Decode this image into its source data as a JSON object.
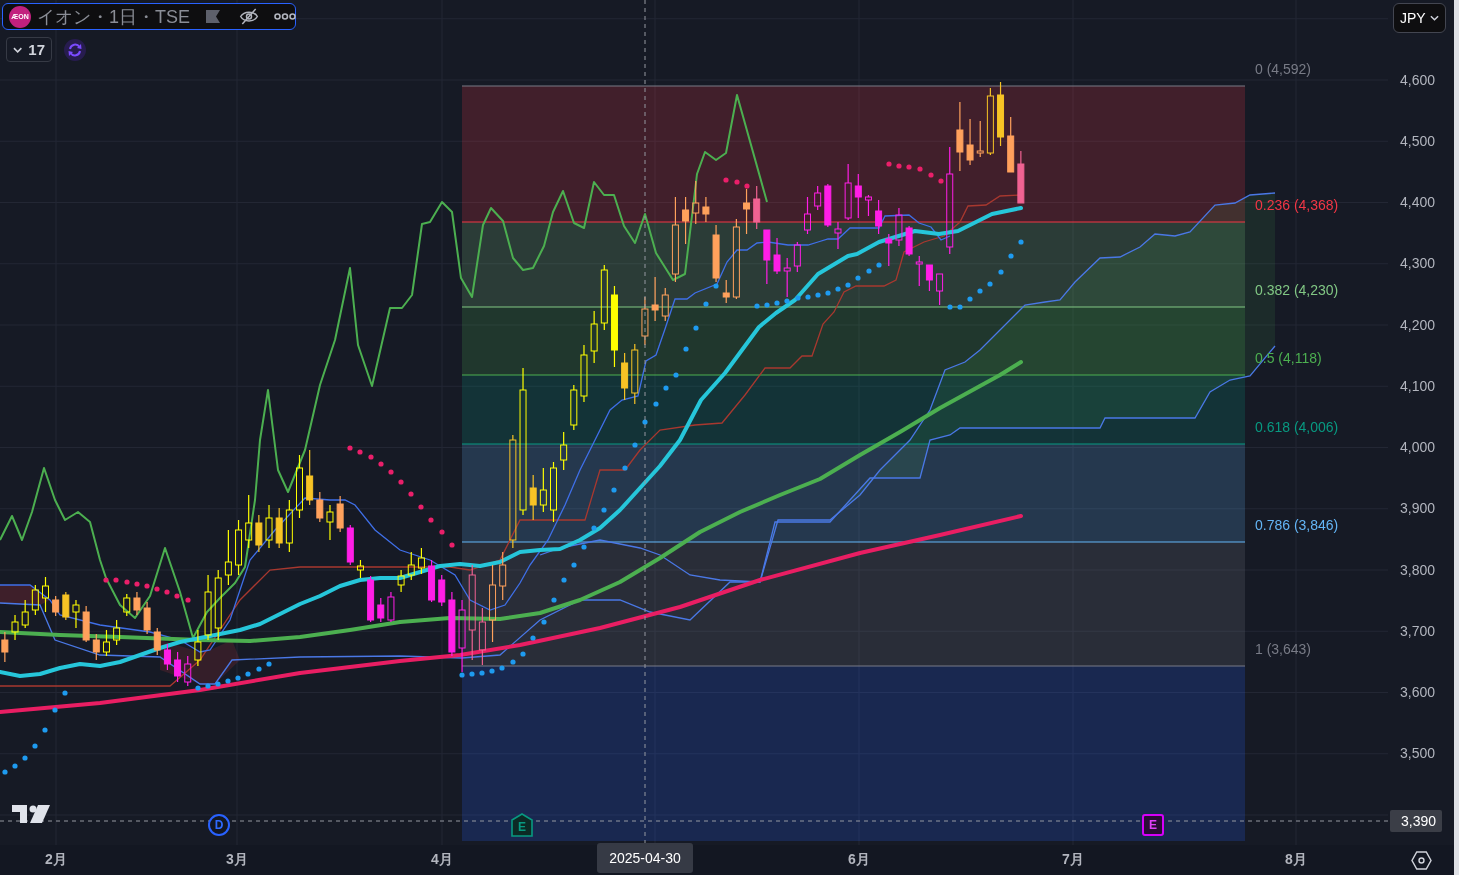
{
  "legend": {
    "logo_text": "ÆON",
    "title": "イオン・1日・TSE",
    "indicator_count": "17"
  },
  "currency_button": {
    "label": "JPY"
  },
  "fibonacci": {
    "levels": [
      {
        "label": "0 (4,592)",
        "color": "#787b86"
      },
      {
        "label": "0.236 (4,368)",
        "color": "#f23645"
      },
      {
        "label": "0.382 (4,230)",
        "color": "#81c784"
      },
      {
        "label": "0.5 (4,118)",
        "color": "#4caf50"
      },
      {
        "label": "0.618 (4,006)",
        "color": "#089981"
      },
      {
        "label": "0.786 (3,846)",
        "color": "#64b5f6"
      },
      {
        "label": "1 (3,643)",
        "color": "#787b86"
      }
    ]
  },
  "events": [
    {
      "kind": "dividend",
      "label": "D"
    },
    {
      "kind": "earnings",
      "label": "E"
    },
    {
      "kind": "earnings_upcoming",
      "label": "E"
    }
  ],
  "price_axis": {
    "labels": [
      "4,600",
      "4,500",
      "4,400",
      "4,300",
      "4,200",
      "4,100",
      "4,000",
      "3,900",
      "3,800",
      "3,700",
      "3,600",
      "3,500"
    ],
    "crosshair_price": "3,390"
  },
  "time_axis": {
    "labels": [
      "2月",
      "3月",
      "4月",
      "6月",
      "7月",
      "8月"
    ],
    "crosshair_date": "2025-04-30"
  }
}
